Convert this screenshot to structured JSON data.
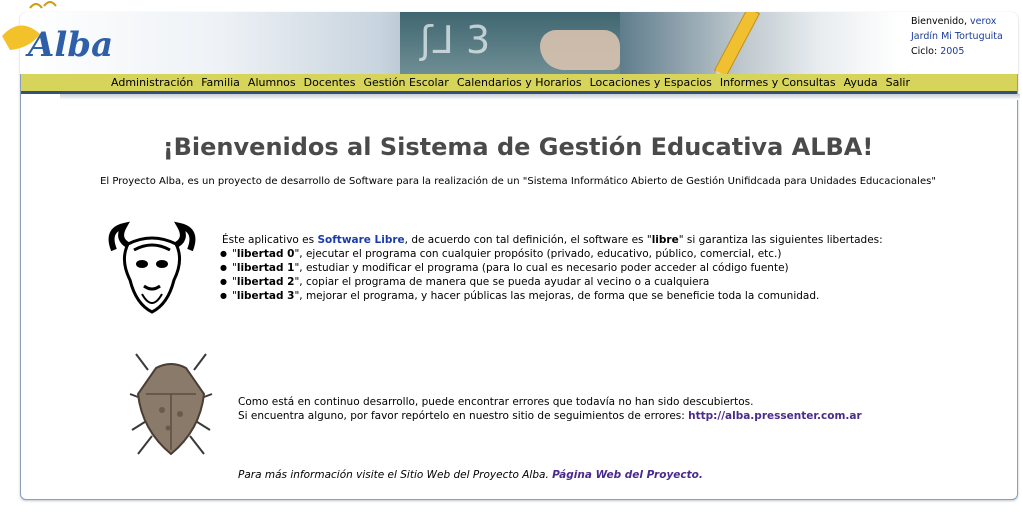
{
  "header": {
    "logo_text": "Alba",
    "welcome_label": "Bienvenido,",
    "user": "verox",
    "school": "Jardín Mi Tortuguita",
    "cycle_label": "Ciclo:",
    "cycle": "2005"
  },
  "menu": {
    "items": [
      "Administración",
      "Familia",
      "Alumnos",
      "Docentes",
      "Gestión Escolar",
      "Calendarios y Horarios",
      "Locaciones y Espacios",
      "Informes y Consultas",
      "Ayuda",
      "Salir"
    ]
  },
  "main": {
    "title": "¡Bienvenidos al Sistema de Gestión Educativa ALBA!",
    "intro": "El Proyecto Alba, es un proyecto de desarrollo de Software para la realización de un \"Sistema Informático Abierto de Gestión Unifidcada para Unidades Educacionales\"",
    "libre_prefix": "Éste aplicativo es ",
    "libre_link": "Software Libre",
    "libre_middle": ", de acuerdo con tal definición, el software es \"",
    "libre_word": "libre",
    "libre_suffix": "\" si garantiza las siguientes libertades:",
    "freedoms": [
      {
        "name": "libertad 0",
        "text": "\", ejecutar el programa con cualquier propósito (privado, educativo, público, comercial, etc.)"
      },
      {
        "name": "libertad 1",
        "text": "\", estudiar y modificar el programa (para lo cual es necesario poder acceder al código fuente)"
      },
      {
        "name": "libertad 2",
        "text": "\", copiar el programa de manera que se pueda ayudar al vecino o a cualquiera"
      },
      {
        "name": "libertad 3",
        "text": "\", mejorar el programa, y hacer públicas las mejoras, de forma que se beneficie toda la comunidad."
      }
    ],
    "errors_line1": "Como está en continuo desarrollo, puede encontrar errores que todavía no han sido descubiertos.",
    "errors_line2": "Si encuentra alguno, por favor repórtelo en nuestro sitio de seguimientos de errores: ",
    "errors_link": "http://alba.pressenter.com.ar",
    "more_text": "Para más información visite el Sitio Web del Proyecto Alba. ",
    "more_link": "Página Web del Proyecto",
    "more_end": "."
  }
}
